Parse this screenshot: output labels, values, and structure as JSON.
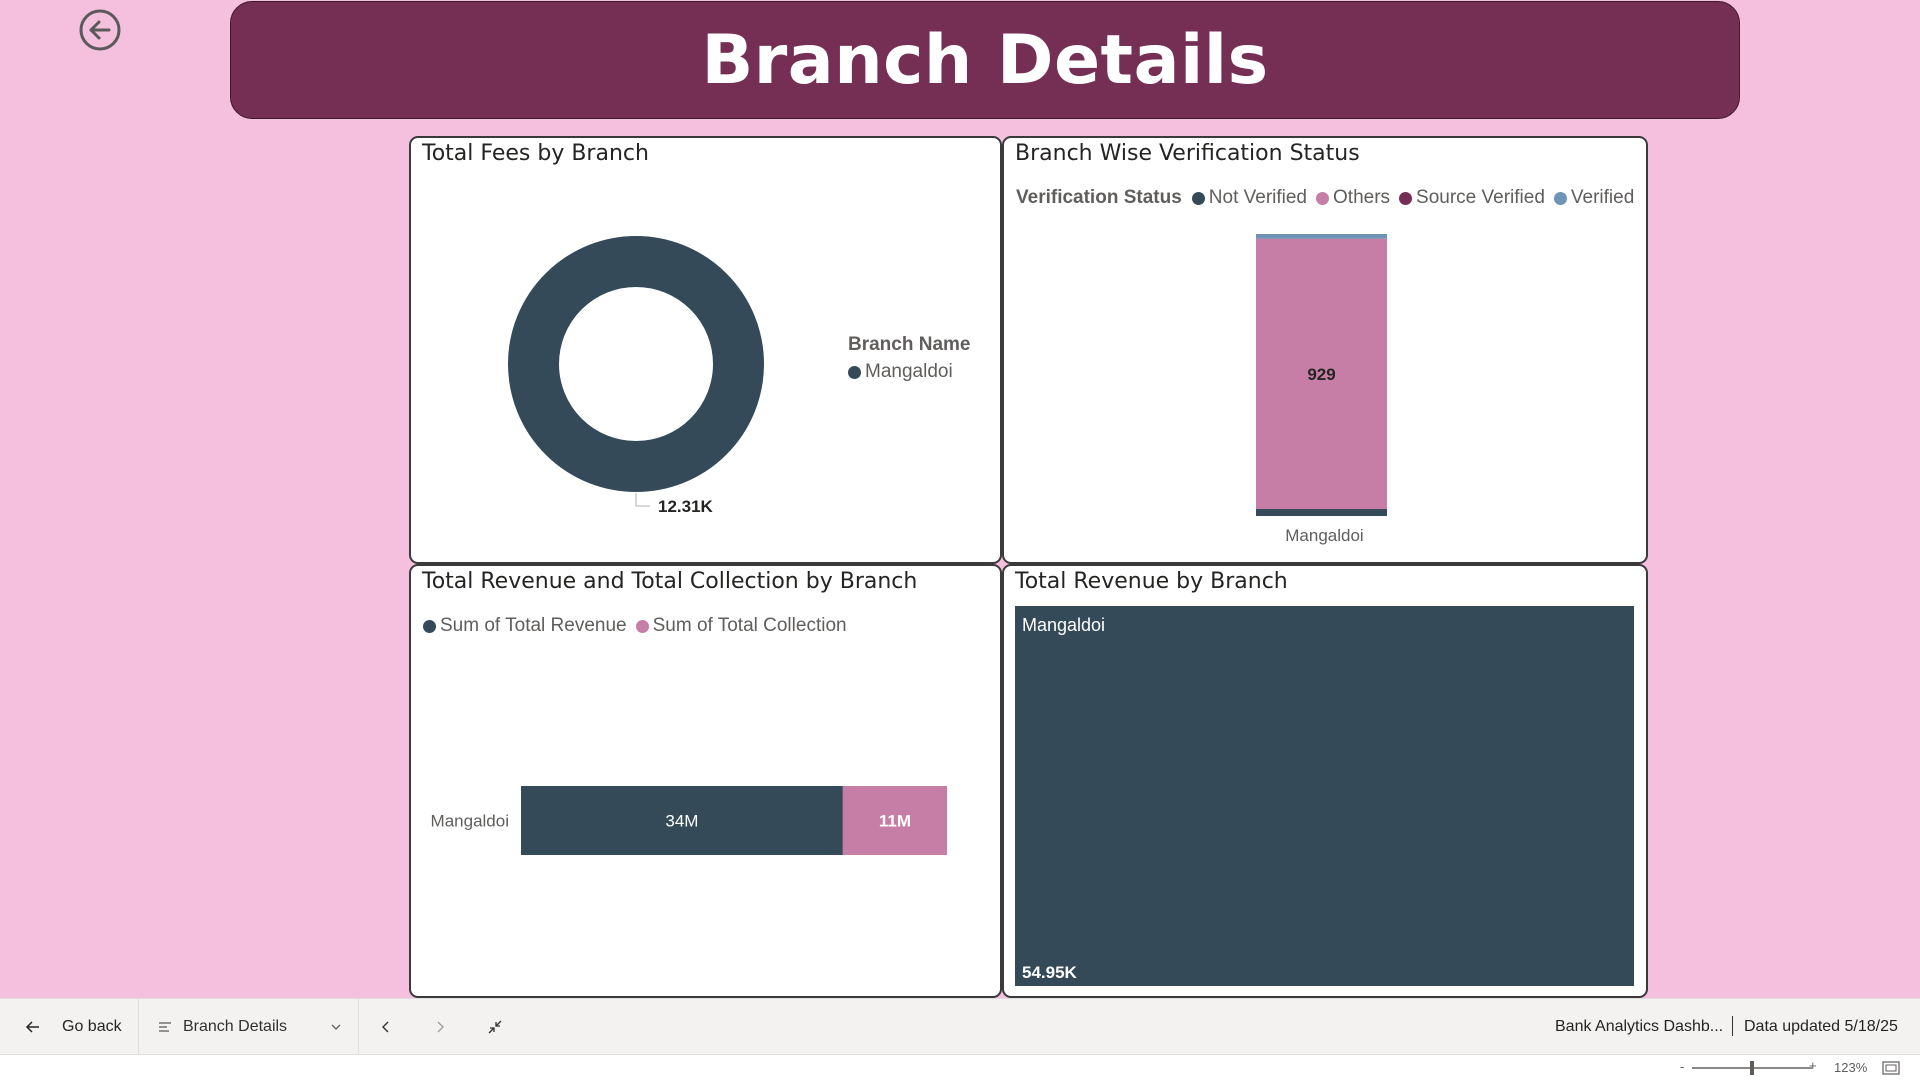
{
  "header": {
    "title": "Branch Details"
  },
  "donut_card": {
    "title": "Total Fees by Branch",
    "legend_title": "Branch Name",
    "legend_items": [
      {
        "label": "Mangaldoi",
        "color": "#344a59"
      }
    ]
  },
  "verification_card": {
    "title": "Branch Wise Verification Status",
    "legend_title": "Verification Status",
    "legend_items": [
      {
        "label": "Not Verified",
        "color": "#344a59"
      },
      {
        "label": "Others",
        "color": "#c77ea6"
      },
      {
        "label": "Source Verified",
        "color": "#762f54"
      },
      {
        "label": "Verified",
        "color": "#6f95b6"
      }
    ]
  },
  "revcoll_card": {
    "title": "Total Revenue and Total Collection by Branch",
    "legend_items": [
      {
        "label": "Sum of Total Revenue",
        "color": "#344a59"
      },
      {
        "label": "Sum of Total Collection",
        "color": "#c77ea6"
      }
    ]
  },
  "treemap_card": {
    "title": "Total Revenue by Branch"
  },
  "chart_data": [
    {
      "type": "pie",
      "title": "Total Fees by Branch",
      "legend_title": "Branch Name",
      "categories": [
        "Mangaldoi"
      ],
      "values": [
        12310
      ],
      "data_labels": [
        "12.31K"
      ],
      "colors": [
        "#344a59"
      ]
    },
    {
      "type": "bar",
      "stacked": true,
      "orientation": "vertical",
      "title": "Branch Wise Verification Status",
      "legend_title": "Verification Status",
      "categories": [
        "Mangaldoi"
      ],
      "series": [
        {
          "name": "Not Verified",
          "values": [
            24
          ],
          "color": "#344a59"
        },
        {
          "name": "Others",
          "values": [
            929
          ],
          "color": "#c77ea6"
        },
        {
          "name": "Source Verified",
          "values": [
            0
          ],
          "color": "#762f54"
        },
        {
          "name": "Verified",
          "values": [
            16
          ],
          "color": "#6f95b6"
        }
      ],
      "data_labels": [
        "929"
      ]
    },
    {
      "type": "bar",
      "stacked": true,
      "orientation": "horizontal",
      "title": "Total Revenue and Total Collection by Branch",
      "categories": [
        "Mangaldoi"
      ],
      "series": [
        {
          "name": "Sum of Total Revenue",
          "values": [
            34000000
          ],
          "label": "34M",
          "color": "#344a59"
        },
        {
          "name": "Sum of Total Collection",
          "values": [
            11000000
          ],
          "label": "11M",
          "color": "#c77ea6"
        }
      ]
    },
    {
      "type": "treemap",
      "title": "Total Revenue by Branch",
      "categories": [
        "Mangaldoi"
      ],
      "values": [
        54950
      ],
      "data_labels": [
        "54.95K"
      ],
      "colors": [
        "#344a59"
      ]
    }
  ],
  "footer": {
    "go_back": "Go back",
    "page_name": "Branch Details",
    "report_name": "Bank Analytics Dashb...",
    "data_updated": "Data updated 5/18/25"
  },
  "status": {
    "zoom_minus": "-",
    "zoom_plus": "+",
    "zoom_level": "123%"
  }
}
